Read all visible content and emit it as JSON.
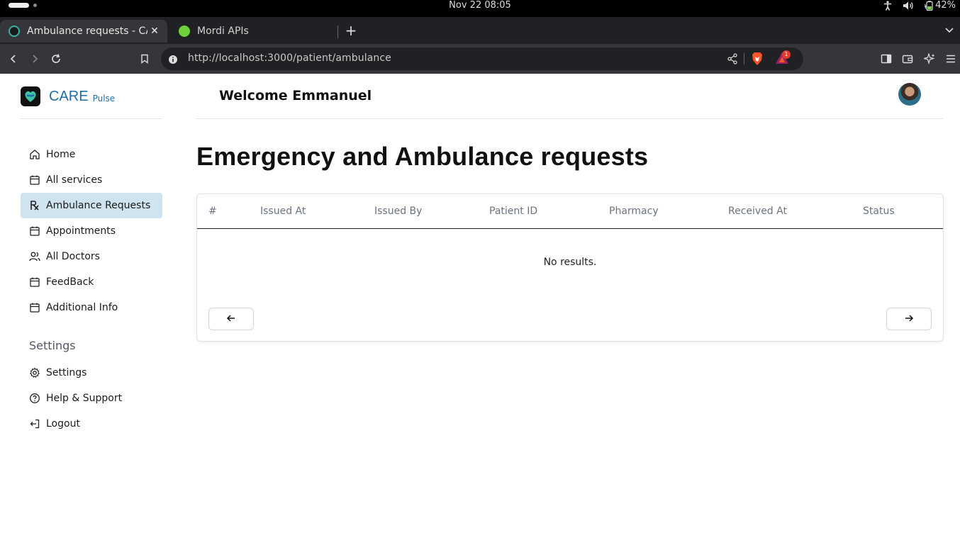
{
  "os": {
    "clock": "Nov 22  08:05",
    "battery": "42%"
  },
  "browser": {
    "tabs": [
      {
        "title": "Ambulance requests - CARE",
        "active": true
      },
      {
        "title": "Mordi APIs",
        "active": false
      }
    ],
    "url": "http://localhost:3000/patient/ambulance",
    "rewards_badge": "1"
  },
  "brand": {
    "name": "CARE",
    "sub": "Pulse"
  },
  "sidebar": {
    "items": [
      {
        "label": "Home",
        "icon": "home-icon"
      },
      {
        "label": "All services",
        "icon": "calendar-icon"
      },
      {
        "label": "Ambulance Requests",
        "icon": "rx-icon",
        "active": true
      },
      {
        "label": "Appointments",
        "icon": "calendar-icon"
      },
      {
        "label": "All Doctors",
        "icon": "users-icon"
      },
      {
        "label": "FeedBack",
        "icon": "calendar-icon"
      },
      {
        "label": "Additional Info",
        "icon": "calendar-icon"
      }
    ],
    "settings_heading": "Settings",
    "settings_items": [
      {
        "label": "Settings",
        "icon": "gear-icon"
      },
      {
        "label": "Help & Support",
        "icon": "help-icon"
      },
      {
        "label": "Logout",
        "icon": "logout-icon"
      }
    ]
  },
  "header": {
    "welcome": "Welcome Emmanuel"
  },
  "page": {
    "title": "Emergency and Ambulance requests"
  },
  "table": {
    "columns": [
      "#",
      "Issued At",
      "Issued By",
      "Patient ID",
      "Pharmacy",
      "Received At",
      "Status"
    ],
    "empty_text": "No results."
  },
  "colors": {
    "brand": "#1d6fa5",
    "active_nav": "#cfe4ef"
  }
}
